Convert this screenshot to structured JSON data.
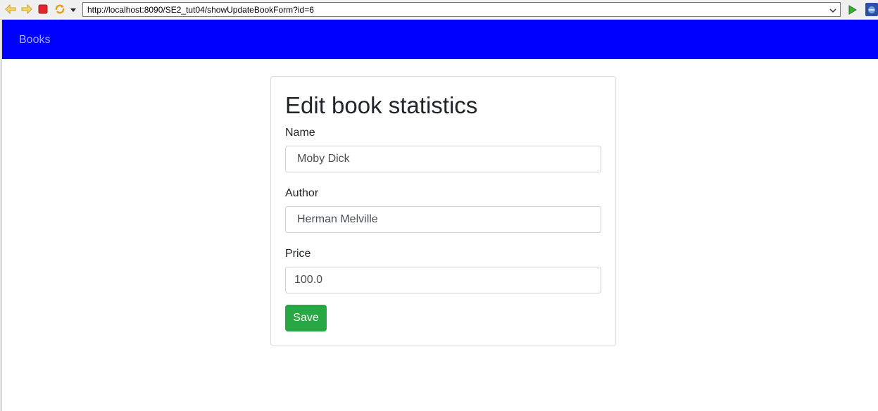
{
  "browser": {
    "url": "http://localhost:8090/SE2_tut04/showUpdateBookForm?id=6",
    "icons": [
      "back-arrow-icon",
      "forward-arrow-icon",
      "stop-icon",
      "refresh-icon",
      "dropdown-arrow-icon",
      "go-icon",
      "extension-icon"
    ]
  },
  "navbar": {
    "brand": "Books",
    "bg_color": "#0000ff"
  },
  "form": {
    "title": "Edit book statistics",
    "fields": [
      {
        "label": "Name",
        "value": "Moby Dick"
      },
      {
        "label": "Author",
        "value": "Herman Melville"
      },
      {
        "label": "Price",
        "value": "100.0"
      }
    ],
    "save_label": "Save",
    "save_color": "#28a745"
  }
}
